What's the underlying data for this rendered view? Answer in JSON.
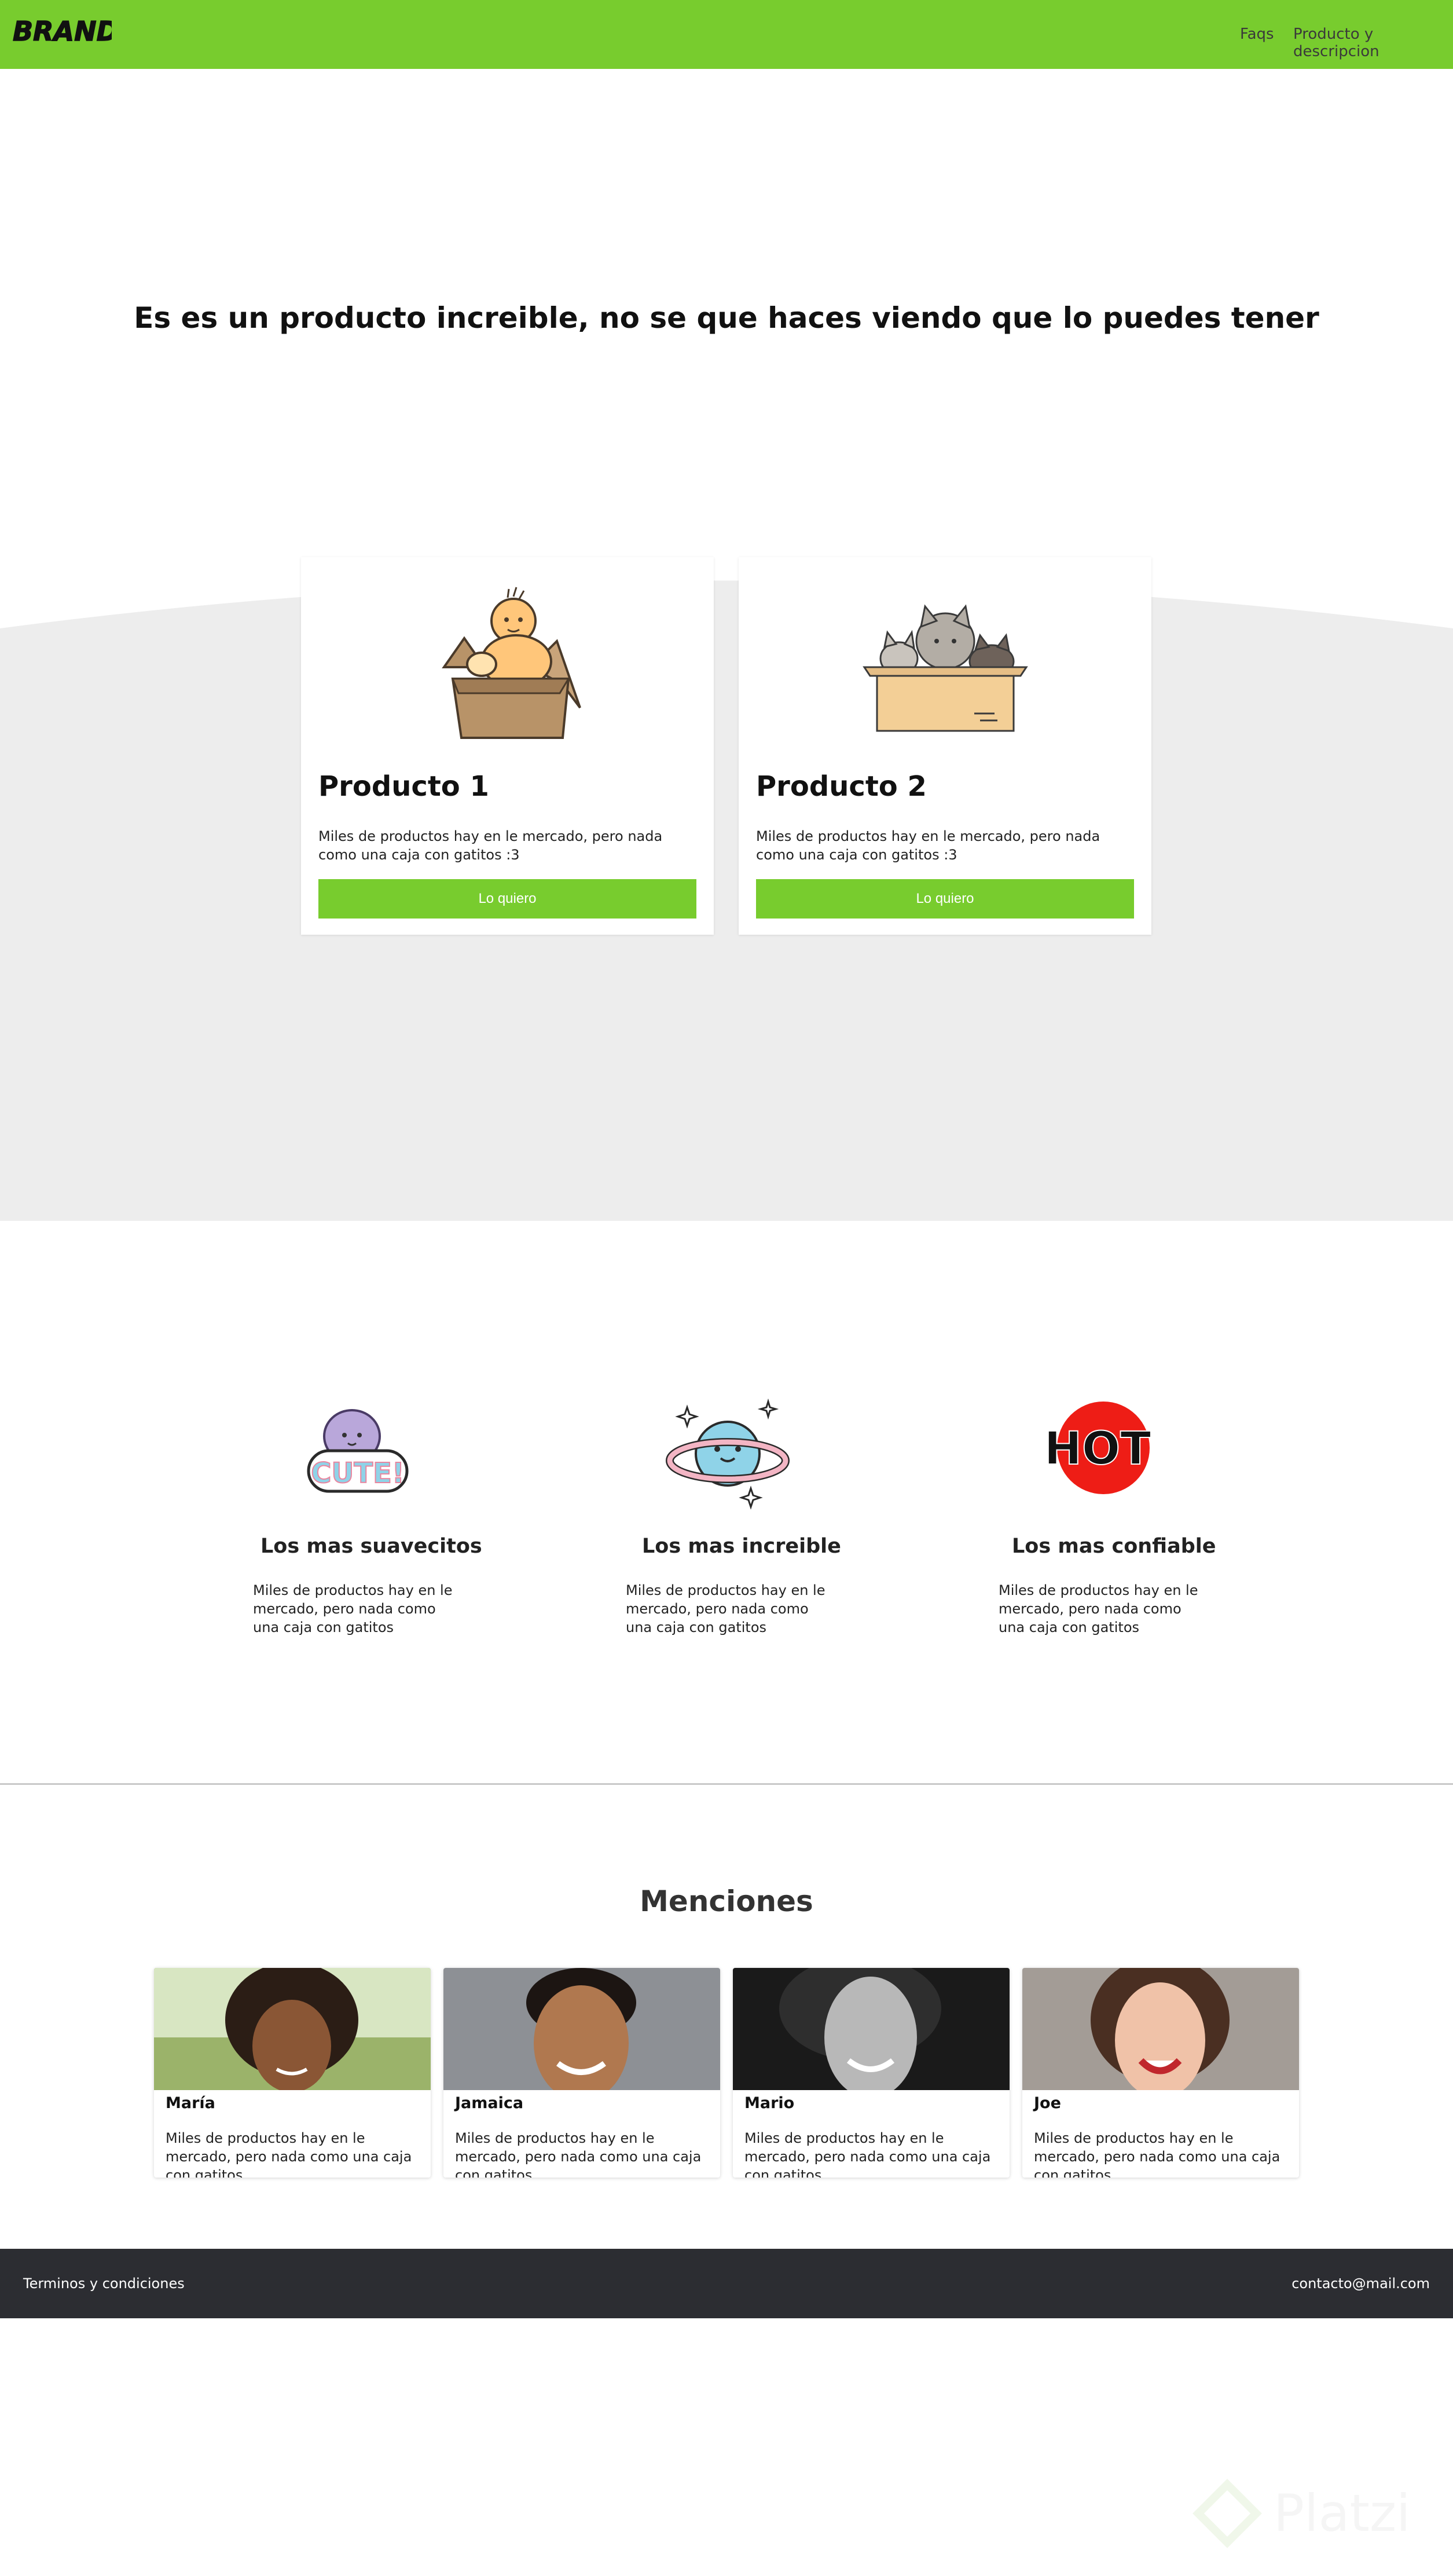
{
  "nav": {
    "brand": "BRAND",
    "links": [
      "Faqs",
      "Producto y descripcion"
    ]
  },
  "hero": {
    "title": "Es es un producto increible, no se que haces viendo que lo puedes tener"
  },
  "products": [
    {
      "title": "Producto 1",
      "text": "Miles de productos hay en le mercado, pero nada como una caja con gatitos :3",
      "button": "Lo quiero"
    },
    {
      "title": "Producto 2",
      "text": "Miles de productos hay en le mercado, pero nada como una caja con gatitos :3",
      "button": "Lo quiero"
    }
  ],
  "features": [
    {
      "title": "Los mas suavecitos",
      "text": "Miles de productos hay en le mercado, pero nada como una caja con gatitos",
      "sticker": "CUTE!"
    },
    {
      "title": "Los mas increible",
      "text": "Miles de productos hay en le mercado, pero nada como una caja con gatitos"
    },
    {
      "title": "Los mas confiable",
      "text": "Miles de productos hay en le mercado, pero nada como una caja con gatitos",
      "sticker": "HOT"
    }
  ],
  "mentions": {
    "title": "Menciones",
    "people": [
      {
        "name": "María",
        "text": "Miles de productos hay en le mercado, pero nada como una caja con gatitos"
      },
      {
        "name": "Jamaica",
        "text": "Miles de productos hay en le mercado, pero nada como una caja con gatitos"
      },
      {
        "name": "Mario",
        "text": "Miles de productos hay en le mercado, pero nada como una caja con gatitos"
      },
      {
        "name": "Joe",
        "text": "Miles de productos hay en le mercado, pero nada como una caja con gatitos"
      }
    ]
  },
  "footer": {
    "left": "Terminos y condiciones",
    "right": "contacto@mail.com"
  },
  "watermark": "Platzi",
  "colors": {
    "accent": "#78cc2e",
    "footer_bg": "#2c2d32",
    "section_bg": "#ededed"
  }
}
